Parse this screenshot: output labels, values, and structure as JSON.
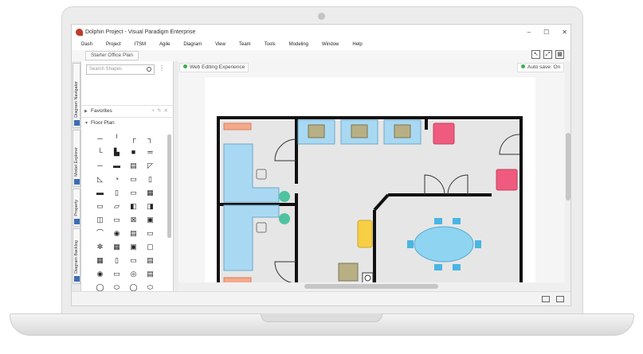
{
  "window": {
    "title": "Dolphin Project - Visual Paradigm Enterprise",
    "controls": [
      "–",
      "☐",
      "✕"
    ]
  },
  "menu": [
    "Dash",
    "Project",
    "ITSM",
    "Agile",
    "Diagram",
    "View",
    "Team",
    "Tools",
    "Modeling",
    "Window",
    "Help"
  ],
  "breadcrumb": "Starter Office Plan",
  "vertical_tabs": [
    "Diagram Navigator",
    "Model Explorer",
    "Property",
    "Diagram Backlog"
  ],
  "shapes_panel": {
    "search_placeholder": "Search Shapes",
    "favorites_label": "Favorites",
    "floor_plan_label": "Floor Plan",
    "shape_glyphs": [
      "─",
      "╵",
      "┌",
      "┐",
      "└",
      "▙",
      "■",
      "═",
      "─",
      "▬",
      "▤",
      "◸",
      "◺",
      "◔",
      "▭",
      "▯",
      "▬",
      "▯",
      "▭",
      "▦",
      "▭",
      "▱",
      "◧",
      "◨",
      "◫",
      "▭",
      "⊠",
      "▣",
      "⌒",
      "◉",
      "▤",
      "▭",
      "✼",
      "▦",
      "▣",
      "▢",
      "▦",
      "▯",
      "▭",
      "▤",
      "◉",
      "▭",
      "◎",
      "▤",
      "◯",
      "⬭",
      "◯",
      "⬭",
      "◯",
      "◯",
      "◯",
      "◯",
      "◯",
      "⬭",
      "⬭",
      "⬭",
      "─"
    ]
  },
  "canvas": {
    "web_editing_label": "Web Editing Experience",
    "autosave_label": "Auto save: On",
    "colors": {
      "wall": "#111111",
      "floor": "#e6e6e6",
      "desk": "#a9d9f2",
      "chair_pink": "#ef5b7e",
      "table_blue": "#8fd4f0",
      "shelf_orange": "#f4a98a",
      "plant_green": "#4fc3a0",
      "armchair_yellow": "#f6cf45",
      "cabinet_olive": "#b8b084"
    }
  }
}
